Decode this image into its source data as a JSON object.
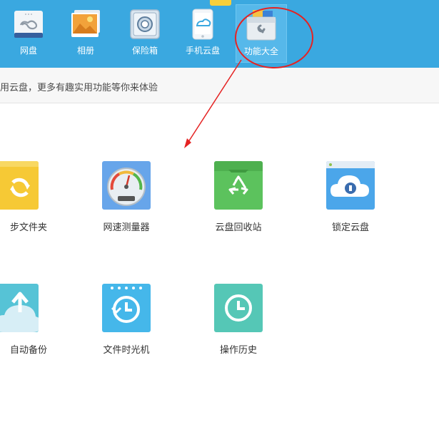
{
  "colors": {
    "topbar": "#3aa8e0",
    "accent_red": "#e52222",
    "folder_yellow": "#f6c935",
    "recycle_green": "#5cc25d",
    "lock_blue": "#4ba6ea",
    "backup_teal": "#56c3d6",
    "timemachine_blue": "#45b7ea",
    "history_teal": "#55c7b6",
    "speed_blue": "#67a5ea"
  },
  "topbar": {
    "items": [
      {
        "label": "网盘",
        "icon": "cloud-drive-icon"
      },
      {
        "label": "相册",
        "icon": "photo-album-icon"
      },
      {
        "label": "保险箱",
        "icon": "safe-icon"
      },
      {
        "label": "手机云盘",
        "icon": "phone-cloud-icon"
      },
      {
        "label": "功能大全",
        "icon": "toolbox-icon",
        "active": true
      }
    ]
  },
  "banner": {
    "text": "用云盘，更多有趣实用功能等你来体验"
  },
  "features": {
    "row1": [
      {
        "label": "步文件夹",
        "icon": "sync-folder-icon"
      },
      {
        "label": "网速测量器",
        "icon": "speedometer-icon"
      },
      {
        "label": "云盘回收站",
        "icon": "recycle-bin-icon"
      },
      {
        "label": "锁定云盘",
        "icon": "lock-cloud-icon"
      }
    ],
    "row2": [
      {
        "label": "自动备份",
        "icon": "auto-backup-icon"
      },
      {
        "label": "文件时光机",
        "icon": "time-machine-icon"
      },
      {
        "label": "操作历史",
        "icon": "history-clock-icon"
      }
    ]
  }
}
